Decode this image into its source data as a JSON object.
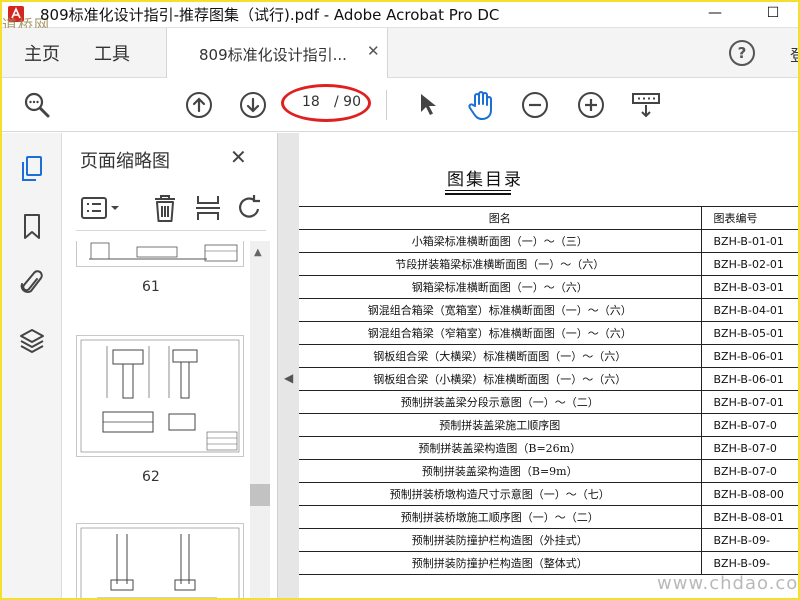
{
  "window": {
    "title": "809标准化设计指引-推荐图集（试行).pdf - Adobe Acrobat Pro DC",
    "minimize_label": "—",
    "maximize_label": "☐",
    "watermark_top": "道桥网"
  },
  "tabs": {
    "home": "主页",
    "tools": "工具",
    "document": "809标准化设计指引...",
    "document_close": "✕",
    "help": "?",
    "login_partial": "登"
  },
  "toolbar": {
    "current_page": "18",
    "total_pages": "/ 90",
    "colors": {
      "accent": "#1a6fd8",
      "highlight_ellipse": "#e02020"
    }
  },
  "thumbnail_panel": {
    "title": "页面缩略图",
    "close": "✕",
    "thumbs": [
      {
        "label": "61"
      },
      {
        "label": "62"
      }
    ]
  },
  "document": {
    "heading": "图集目录",
    "columns": [
      "图名",
      "图表编号"
    ],
    "rows": [
      {
        "name": "小箱梁标准横断面图（一）～（三）",
        "code": "BZH-B-01-01"
      },
      {
        "name": "节段拼装箱梁标准横断面图（一）～（六）",
        "code": "BZH-B-02-01"
      },
      {
        "name": "钢箱梁标准横断面图（一）～（六）",
        "code": "BZH-B-03-01"
      },
      {
        "name": "钢混组合箱梁（宽箱室）标准横断面图（一）～（六）",
        "code": "BZH-B-04-01"
      },
      {
        "name": "钢混组合箱梁（窄箱室）标准横断面图（一）～（六）",
        "code": "BZH-B-05-01"
      },
      {
        "name": "钢板组合梁（大横梁）标准横断面图（一）～（六）",
        "code": "BZH-B-06-01"
      },
      {
        "name": "钢板组合梁（小横梁）标准横断面图（一）～（六）",
        "code": "BZH-B-06-01"
      },
      {
        "name": "预制拼装盖梁分段示意图（一）～（二）",
        "code": "BZH-B-07-01"
      },
      {
        "name": "预制拼装盖梁施工顺序图",
        "code": "BZH-B-07-0"
      },
      {
        "name": "预制拼装盖梁构造图（B=26m）",
        "code": "BZH-B-07-0"
      },
      {
        "name": "预制拼装盖梁构造图（B=9m）",
        "code": "BZH-B-07-0"
      },
      {
        "name": "预制拼装桥墩构造尺寸示意图（一）～（七）",
        "code": "BZH-B-08-00"
      },
      {
        "name": "预制拼装桥墩施工顺序图（一）～（二）",
        "code": "BZH-B-08-01"
      },
      {
        "name": "预制拼装防撞护栏构造图（外挂式）",
        "code": "BZH-B-09-"
      },
      {
        "name": "预制拼装防撞护栏构造图（整体式）",
        "code": "BZH-B-09-"
      }
    ],
    "watermark": "www.chdao.com"
  }
}
